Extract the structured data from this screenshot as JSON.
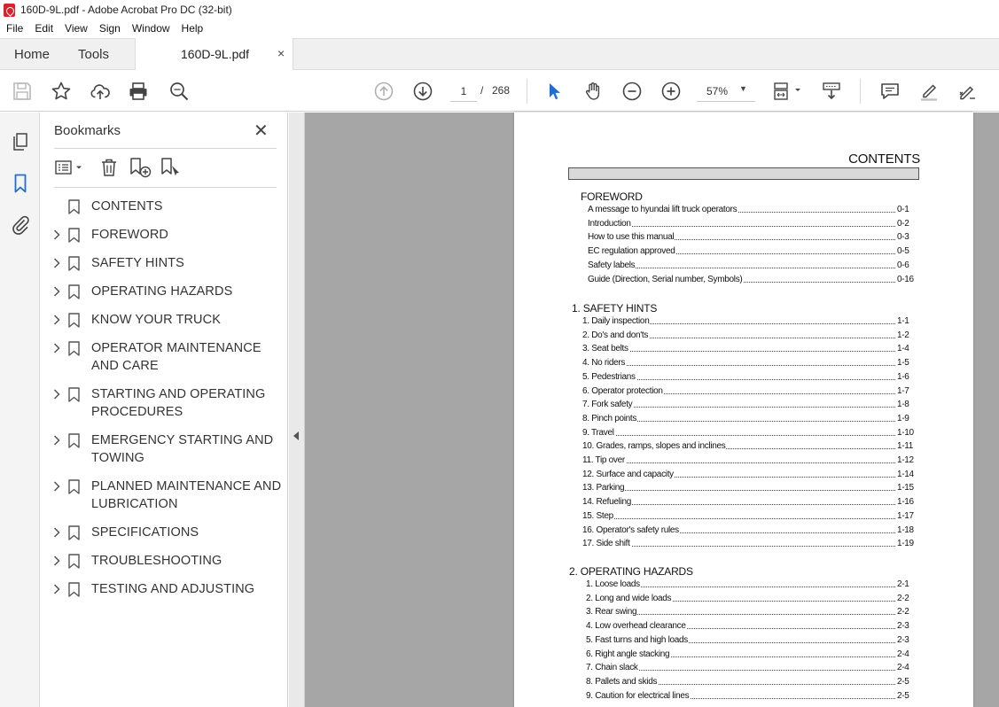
{
  "window": {
    "title": "160D-9L.pdf - Adobe Acrobat Pro DC (32-bit)"
  },
  "menu": [
    "File",
    "Edit",
    "View",
    "Sign",
    "Window",
    "Help"
  ],
  "tabs": {
    "home": "Home",
    "tools": "Tools",
    "doc": "160D-9L.pdf",
    "close": "×"
  },
  "toolbar": {
    "page_current": "1",
    "page_sep": "/",
    "page_total": "268",
    "zoom": "57%"
  },
  "bookmarks": {
    "title": "Bookmarks",
    "close": "✕",
    "items": [
      {
        "label": "CONTENTS",
        "expandable": false
      },
      {
        "label": "FOREWORD",
        "expandable": true
      },
      {
        "label": "SAFETY HINTS",
        "expandable": true
      },
      {
        "label": "OPERATING HAZARDS",
        "expandable": true
      },
      {
        "label": "KNOW YOUR TRUCK",
        "expandable": true
      },
      {
        "label": "OPERATOR MAINTENANCE AND CARE",
        "expandable": true
      },
      {
        "label": "STARTING AND OPERATING PROCEDURES",
        "expandable": true
      },
      {
        "label": "EMERGENCY STARTING AND TOWING",
        "expandable": true
      },
      {
        "label": "PLANNED MAINTENANCE AND LUBRICATION",
        "expandable": true
      },
      {
        "label": "SPECIFICATIONS",
        "expandable": true
      },
      {
        "label": "TROUBLESHOOTING",
        "expandable": true
      },
      {
        "label": "TESTING AND ADJUSTING",
        "expandable": true
      }
    ]
  },
  "document": {
    "title": "CONTENTS",
    "sections": [
      {
        "heading": "FOREWORD",
        "entries": [
          {
            "text": "A message to hyundai lift truck operators",
            "page": "0-1"
          },
          {
            "text": "Introduction",
            "page": "0-2"
          },
          {
            "text": "How to use this manual",
            "page": "0-3"
          },
          {
            "text": "EC regulation approved",
            "page": "0-5"
          },
          {
            "text": "Safety labels",
            "page": "0-6"
          },
          {
            "text": "Guide (Direction, Serial number, Symbols)",
            "page": "0-16"
          }
        ]
      },
      {
        "heading": "1. SAFETY HINTS",
        "entries": [
          {
            "text": "1. Daily inspection",
            "page": "1-1"
          },
          {
            "text": "2. Do's and don'ts",
            "page": "1-2"
          },
          {
            "text": "3. Seat belts",
            "page": "1-4"
          },
          {
            "text": "4. No riders",
            "page": "1-5"
          },
          {
            "text": "5. Pedestrians",
            "page": "1-6"
          },
          {
            "text": "6. Operator protection",
            "page": "1-7"
          },
          {
            "text": "7. Fork safety",
            "page": "1-8"
          },
          {
            "text": "8. Pinch points",
            "page": "1-9"
          },
          {
            "text": "9. Travel",
            "page": "1-10"
          },
          {
            "text": "10. Grades, ramps, slopes and inclines",
            "page": "1-11"
          },
          {
            "text": "11. Tip over",
            "page": "1-12"
          },
          {
            "text": "12. Surface and capacity",
            "page": "1-14"
          },
          {
            "text": "13. Parking",
            "page": "1-15"
          },
          {
            "text": "14. Refueling",
            "page": "1-16"
          },
          {
            "text": "15. Step",
            "page": "1-17"
          },
          {
            "text": "16. Operator's safety rules",
            "page": "1-18"
          },
          {
            "text": "17. Side shift",
            "page": "1-19"
          }
        ]
      },
      {
        "heading": "2. OPERATING HAZARDS",
        "entries": [
          {
            "text": "1. Loose loads",
            "page": "2-1"
          },
          {
            "text": "2. Long and wide loads",
            "page": "2-2"
          },
          {
            "text": "3. Rear swing",
            "page": "2-2"
          },
          {
            "text": "4. Low overhead clearance",
            "page": "2-3"
          },
          {
            "text": "5. Fast turns and high loads",
            "page": "2-3"
          },
          {
            "text": "6. Right angle stacking",
            "page": "2-4"
          },
          {
            "text": "7. Chain slack",
            "page": "2-4"
          },
          {
            "text": "8. Pallets and skids",
            "page": "2-5"
          },
          {
            "text": "9. Caution for electrical lines",
            "page": "2-5"
          }
        ]
      }
    ]
  }
}
